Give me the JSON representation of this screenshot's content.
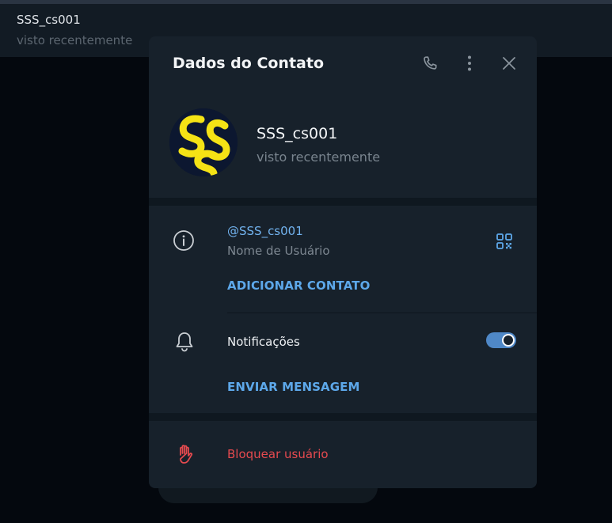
{
  "chat": {
    "name": "SSS_cs001",
    "status": "visto recentemente"
  },
  "modal": {
    "title": "Dados do Contato",
    "icons": {
      "call": "phone-icon",
      "more": "more-vertical-icon",
      "close": "close-icon",
      "info": "info-icon",
      "qr": "qr-code-icon",
      "bell": "bell-icon",
      "block": "hand-stop-icon"
    },
    "profile": {
      "name": "SSS_cs001",
      "status": "visto recentemente"
    },
    "username": {
      "value": "@SSS_cs001",
      "label": "Nome de Usuário",
      "action": "ADICIONAR CONTATO"
    },
    "notifications": {
      "label": "Notificações",
      "enabled": true,
      "action": "ENVIAR MENSAGEM"
    },
    "block": {
      "label": "Bloquear usuário"
    }
  },
  "colors": {
    "accent": "#5da8ea",
    "danger": "#e54a4f",
    "toggle_on": "#4f88c7",
    "avatar_yellow": "#f5e315",
    "avatar_bg": "#0c1730"
  }
}
